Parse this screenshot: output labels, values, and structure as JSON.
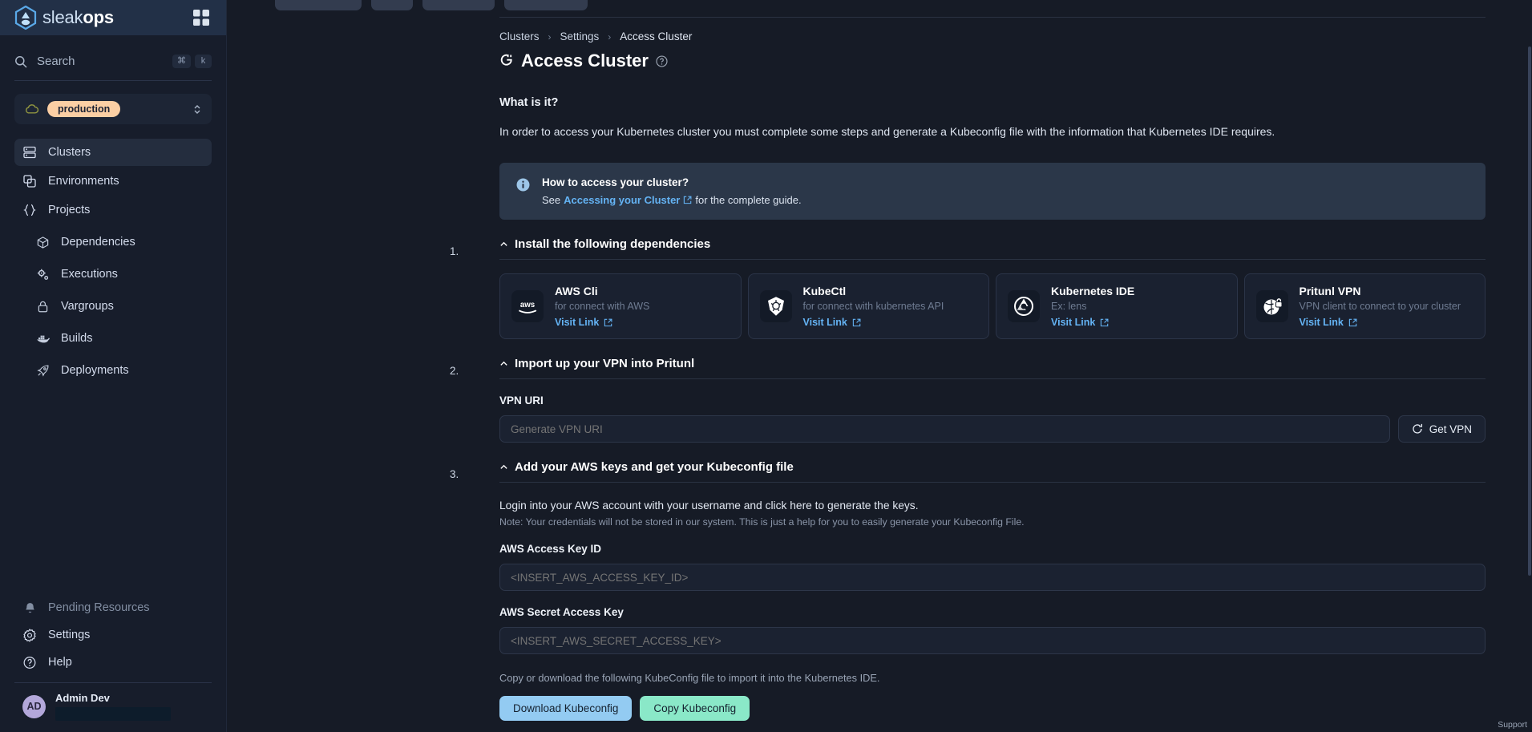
{
  "brand": {
    "name_light": "sleak",
    "name_bold": "ops",
    "grid_icon": "grid-icon"
  },
  "sidebar": {
    "search": {
      "placeholder": "Search",
      "kbd_cmd": "⌘",
      "kbd_key": "k"
    },
    "env": {
      "value": "production",
      "icon": "cloud-icon",
      "chevron": "chevron-updown-icon"
    },
    "nav": [
      {
        "label": "Clusters",
        "icon": "server-icon",
        "active": true,
        "sub": false
      },
      {
        "label": "Environments",
        "icon": "copy-icon",
        "active": false,
        "sub": false
      },
      {
        "label": "Projects",
        "icon": "braces-icon",
        "active": false,
        "sub": false
      },
      {
        "label": "Dependencies",
        "icon": "cube-icon",
        "active": false,
        "sub": true
      },
      {
        "label": "Executions",
        "icon": "cogs-icon",
        "active": false,
        "sub": true
      },
      {
        "label": "Vargroups",
        "icon": "lock-icon",
        "active": false,
        "sub": true
      },
      {
        "label": "Builds",
        "icon": "docker-icon",
        "active": false,
        "sub": true
      },
      {
        "label": "Deployments",
        "icon": "rocket-icon",
        "active": false,
        "sub": true
      }
    ],
    "bottom": [
      {
        "label": "Pending Resources",
        "icon": "bell-icon",
        "muted": true
      },
      {
        "label": "Settings",
        "icon": "gear-icon",
        "muted": false
      },
      {
        "label": "Help",
        "icon": "question-icon",
        "muted": false
      }
    ],
    "user": {
      "initials": "AD",
      "name": "Admin Dev"
    }
  },
  "breadcrumb": {
    "items": [
      "Clusters",
      "Settings",
      "Access Cluster"
    ],
    "separator": "›"
  },
  "page": {
    "title": "Access Cluster",
    "title_icon": "plug-icon",
    "help_icon": "question-circle-icon",
    "what_heading": "What is it?",
    "intro": "In order to access your Kubernetes cluster you must complete some steps and generate a Kubeconfig file with the information that Kubernetes IDE requires."
  },
  "banner": {
    "icon": "info-icon",
    "title": "How to access your cluster?",
    "see_prefix": "See",
    "link_text": "Accessing your Cluster",
    "link_icon": "external-link-icon",
    "suffix": "for the complete guide."
  },
  "steps": [
    {
      "num": "1.",
      "caret": "chevron-up-icon",
      "title": "Install the following dependencies"
    },
    {
      "num": "2.",
      "caret": "chevron-up-icon",
      "title": "Import up your VPN into Pritunl"
    },
    {
      "num": "3.",
      "caret": "chevron-up-icon",
      "title": "Add your AWS keys and get your Kubeconfig file"
    }
  ],
  "dependencies": [
    {
      "logo": "aws-logo-icon",
      "title": "AWS Cli",
      "subtitle": "for connect with AWS",
      "link": "Visit Link",
      "link_icon": "external-link-icon"
    },
    {
      "logo": "kubernetes-logo-icon",
      "title": "KubeCtl",
      "subtitle": "for connect with kubernetes API",
      "link": "Visit Link",
      "link_icon": "external-link-icon"
    },
    {
      "logo": "lens-logo-icon",
      "title": "Kubernetes IDE",
      "subtitle": "Ex: lens",
      "link": "Visit Link",
      "link_icon": "external-link-icon"
    },
    {
      "logo": "pritunl-logo-icon",
      "title": "Pritunl VPN",
      "subtitle": "VPN client to connect to your cluster",
      "link": "Visit Link",
      "link_icon": "external-link-icon"
    }
  ],
  "vpn": {
    "label": "VPN URI",
    "input_placeholder": "Generate VPN URI",
    "input_value": "",
    "button_label": "Get VPN",
    "button_icon": "refresh-icon"
  },
  "aws": {
    "login_text": "Login into your AWS account with your username and click here to generate the keys.",
    "note_text": "Note: Your credentials will not be stored in our system. This is just a help for you to easily generate your Kubeconfig File.",
    "access_key_label": "AWS Access Key ID",
    "access_key_placeholder": "<INSERT_AWS_ACCESS_KEY_ID>",
    "secret_key_label": "AWS Secret Access Key",
    "secret_key_placeholder": "<INSERT_AWS_SECRET_ACCESS_KEY>",
    "copy_text": "Copy or download the following KubeConfig file to import it into the Kubernetes IDE.",
    "download_button": "Download Kubeconfig",
    "copy_button": "Copy Kubeconfig"
  },
  "support": {
    "label": "Support"
  },
  "colors": {
    "accent_blue": "#64b3f4",
    "env_pill": "#fbcfa4",
    "download_btn": "#93cbf2",
    "copy_btn": "#8ae8c8",
    "sidebar_bg": "#171d2b",
    "main_bg": "#161b26"
  }
}
